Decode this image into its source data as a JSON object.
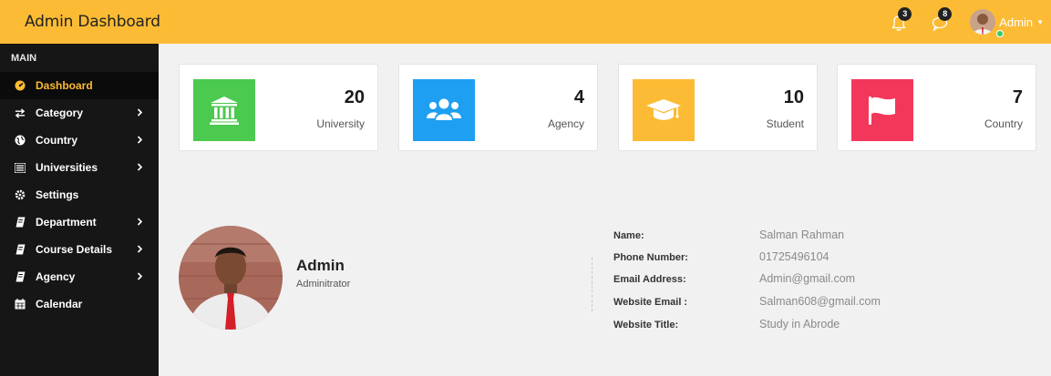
{
  "header": {
    "title": "Admin Dashboard",
    "notifications_count": "3",
    "messages_count": "8",
    "user_name": "Admin",
    "caret_icon": "caret-down-icon",
    "bar_color": "#fcbb34"
  },
  "sidebar": {
    "section_title": "MAIN",
    "items": [
      {
        "label": "Dashboard",
        "icon": "tachometer-icon",
        "active": true
      },
      {
        "label": "Category",
        "icon": "exchange-icon",
        "has_chevron": true
      },
      {
        "label": "Country",
        "icon": "globe-icon",
        "has_chevron": true
      },
      {
        "label": "Universities",
        "icon": "list-icon",
        "has_chevron": true
      },
      {
        "label": "Settings",
        "icon": "gear-icon"
      },
      {
        "label": "Department",
        "icon": "book-icon",
        "has_chevron": true
      },
      {
        "label": "Course Details",
        "icon": "book-icon",
        "has_chevron": true
      },
      {
        "label": "Agency",
        "icon": "book-icon",
        "has_chevron": true
      },
      {
        "label": "Calendar",
        "icon": "calendar-icon"
      }
    ],
    "accent_color": "#fcbb34"
  },
  "stats": [
    {
      "value": "20",
      "label": "University",
      "icon": "university-icon",
      "color": "#4cc94f"
    },
    {
      "value": "4",
      "label": "Agency",
      "icon": "users-icon",
      "color": "#1e9ff2"
    },
    {
      "value": "10",
      "label": "Student",
      "icon": "graduation-cap-icon",
      "color": "#fcbb34"
    },
    {
      "value": "7",
      "label": "Country",
      "icon": "flag-icon",
      "color": "#f2375b"
    }
  ],
  "profile": {
    "name": "Admin",
    "role": "Adminitrator",
    "details": [
      {
        "label": "Name:",
        "value": "Salman Rahman"
      },
      {
        "label": "Phone Number:",
        "value": "01725496104"
      },
      {
        "label": "Email Address:",
        "value": "Admin@gmail.com"
      },
      {
        "label": "Website Email :",
        "value": "Salman608@gmail.com"
      },
      {
        "label": "Website Title:",
        "value": "Study in Abrode"
      }
    ]
  }
}
